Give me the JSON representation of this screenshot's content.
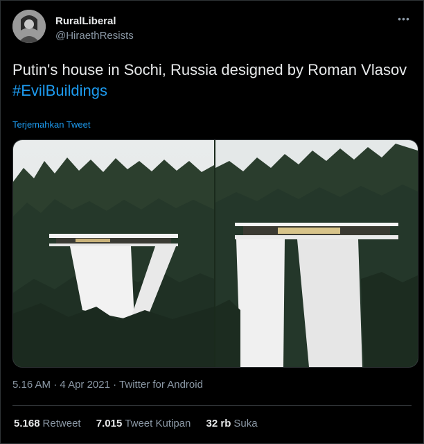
{
  "user": {
    "display_name": "RuralLiberal",
    "handle": "@HiraethResists"
  },
  "tweet": {
    "text": "Putin's house in Sochi, Russia designed by Roman Vlasov",
    "hashtag": "#EvilBuildings",
    "translate_label": "Terjemahkan Tweet"
  },
  "media": {
    "photos": [
      {
        "name": "photo-left"
      },
      {
        "name": "photo-right"
      }
    ]
  },
  "meta": {
    "time": "5.16 AM",
    "date": "4 Apr 2021",
    "source": "Twitter for Android"
  },
  "stats": {
    "retweets_value": "5.168",
    "retweets_label": "Retweet",
    "quotes_value": "7.015",
    "quotes_label": "Tweet Kutipan",
    "likes_value": "32 rb",
    "likes_label": "Suka"
  },
  "icons": {
    "more": "more-dots-icon"
  },
  "colors": {
    "background": "#000000",
    "link": "#1d9bf0",
    "secondary_text": "#8b98a5",
    "divider": "#2f3336"
  }
}
